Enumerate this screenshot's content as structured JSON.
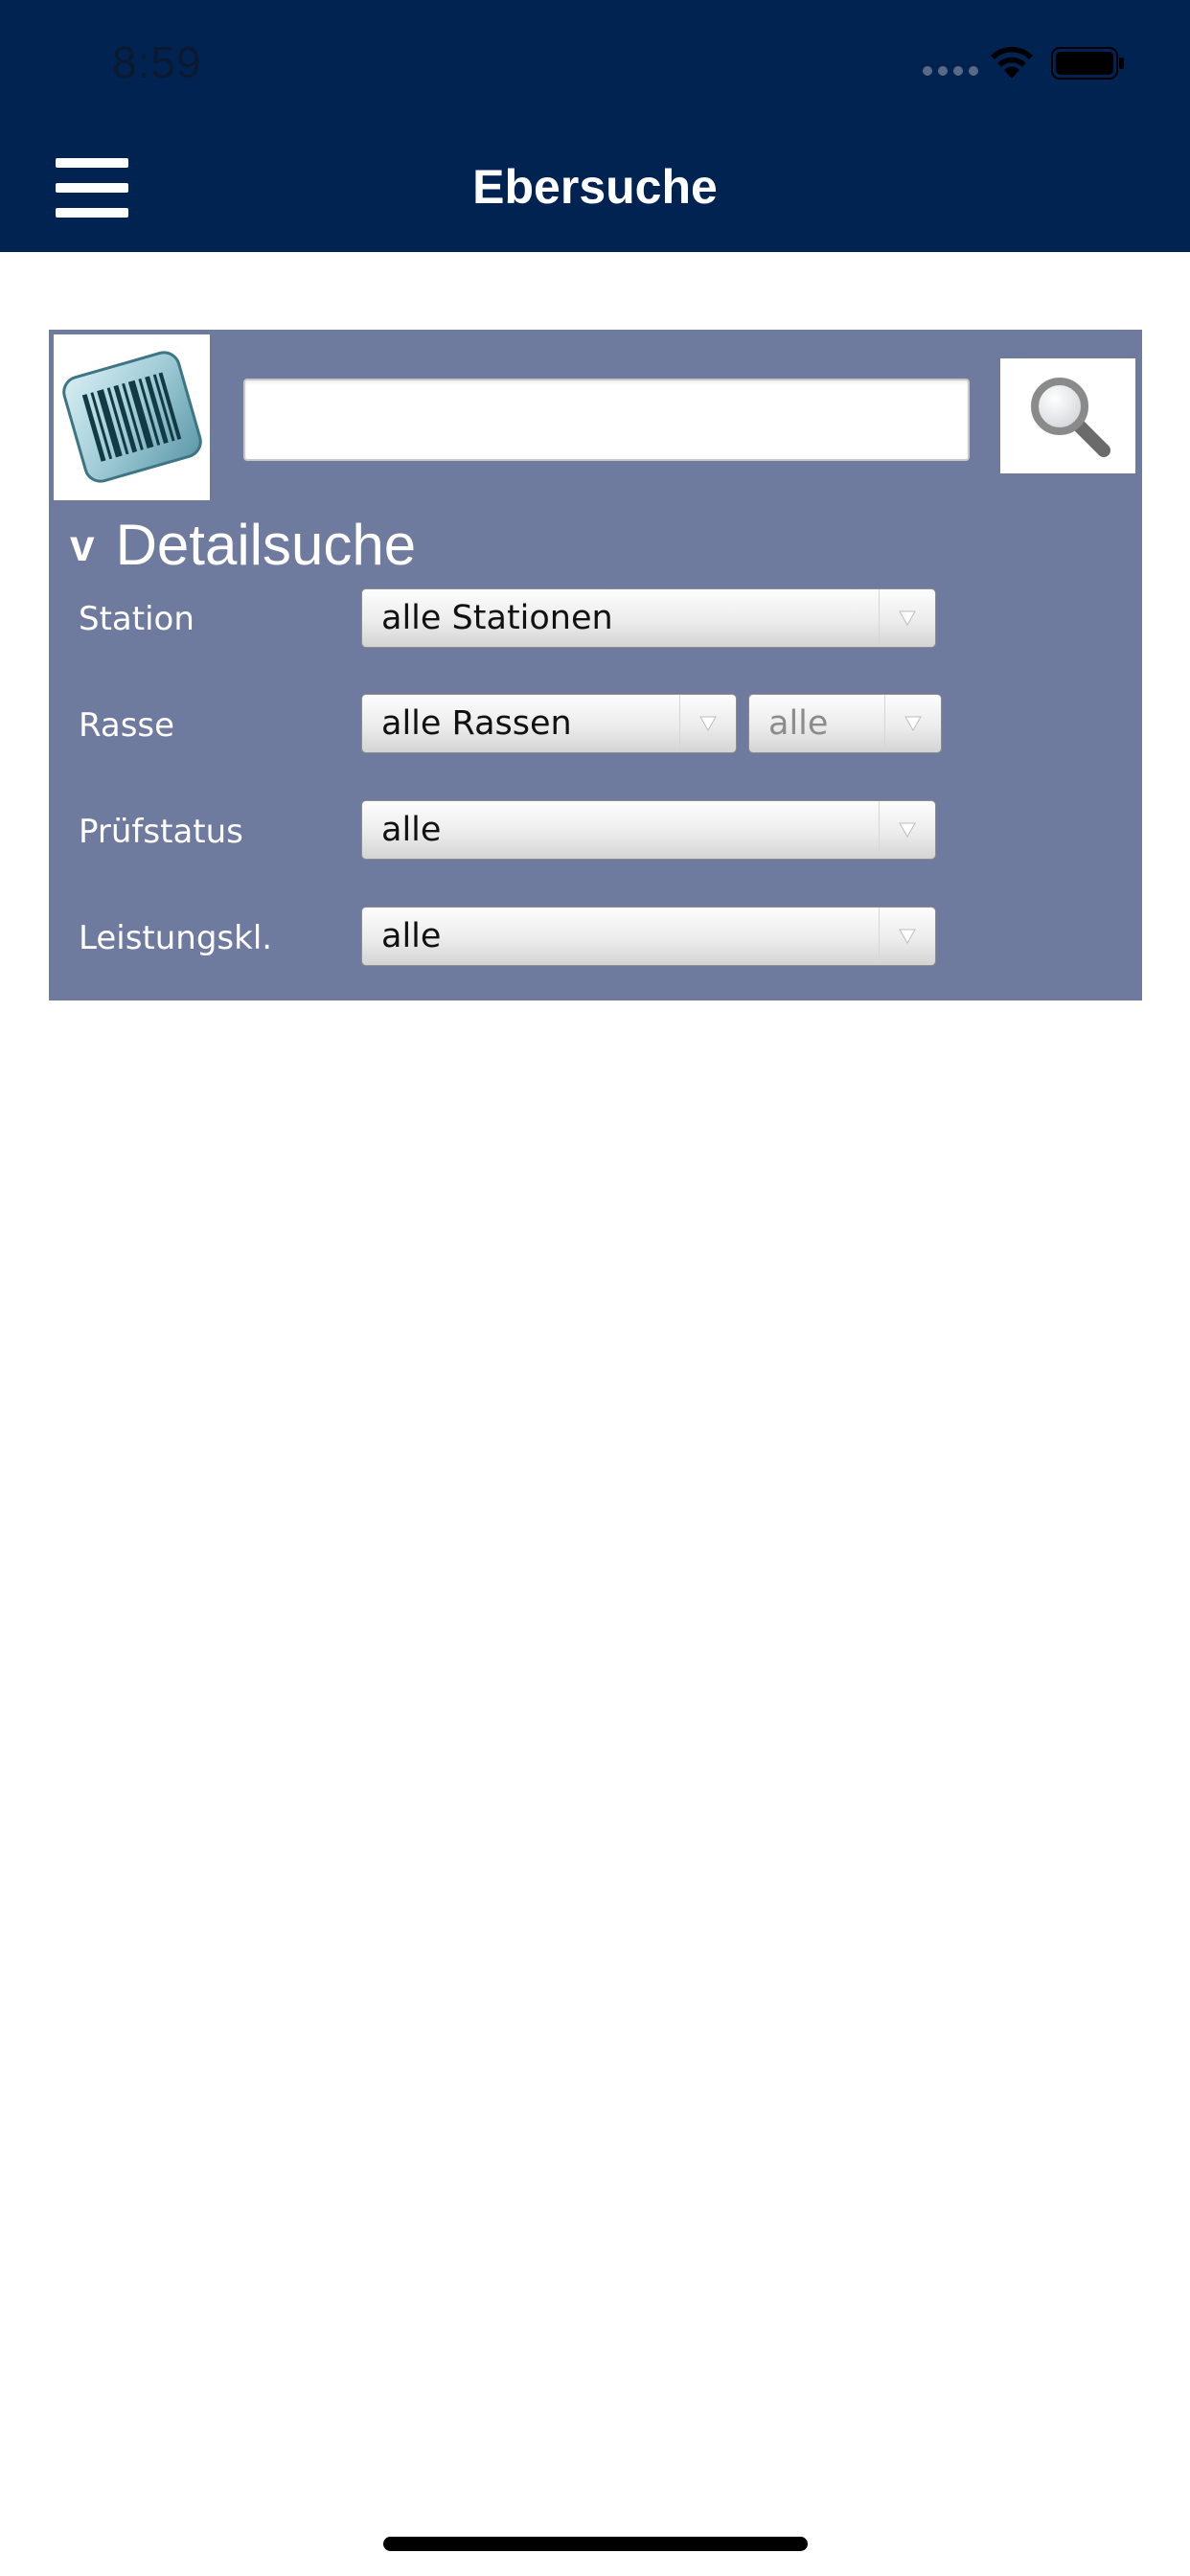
{
  "status_bar": {
    "time": "8:59",
    "icons": [
      "cellular-dots-icon",
      "wifi-icon",
      "battery-icon"
    ]
  },
  "nav": {
    "title": "Ebersuche",
    "menu_icon": "hamburger-menu-icon"
  },
  "search": {
    "barcode_icon": "barcode-icon",
    "input_value": "",
    "input_placeholder": "",
    "search_icon": "magnifier-icon"
  },
  "detail": {
    "toggle_symbol": "v",
    "title": "Detailsuche",
    "fields": {
      "station": {
        "label": "Station",
        "value": "alle Stationen"
      },
      "rasse": {
        "label": "Rasse",
        "value": "alle Rassen",
        "secondary_value": "alle"
      },
      "pruefstatus": {
        "label": "Prüfstatus",
        "value": "alle"
      },
      "leistungsklasse": {
        "label": "Leistungskl.",
        "value": "alle"
      }
    }
  },
  "colors": {
    "header": "#012352",
    "panel": "#6e7a9e",
    "text_light": "#ffffff"
  }
}
